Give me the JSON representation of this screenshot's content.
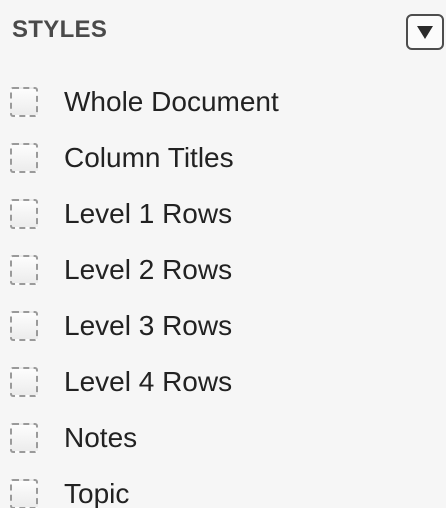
{
  "panel": {
    "title": "STYLES",
    "menu_icon": "triangle-down-icon"
  },
  "styles": {
    "items": [
      {
        "label": "Whole Document"
      },
      {
        "label": "Column Titles"
      },
      {
        "label": "Level 1 Rows"
      },
      {
        "label": "Level 2 Rows"
      },
      {
        "label": "Level 3 Rows"
      },
      {
        "label": "Level 4 Rows"
      },
      {
        "label": "Notes"
      },
      {
        "label": "Topic"
      }
    ]
  },
  "colors": {
    "background": "#f6f6f6",
    "text": "#222222",
    "checkbox_border": "#9a9a9a"
  }
}
